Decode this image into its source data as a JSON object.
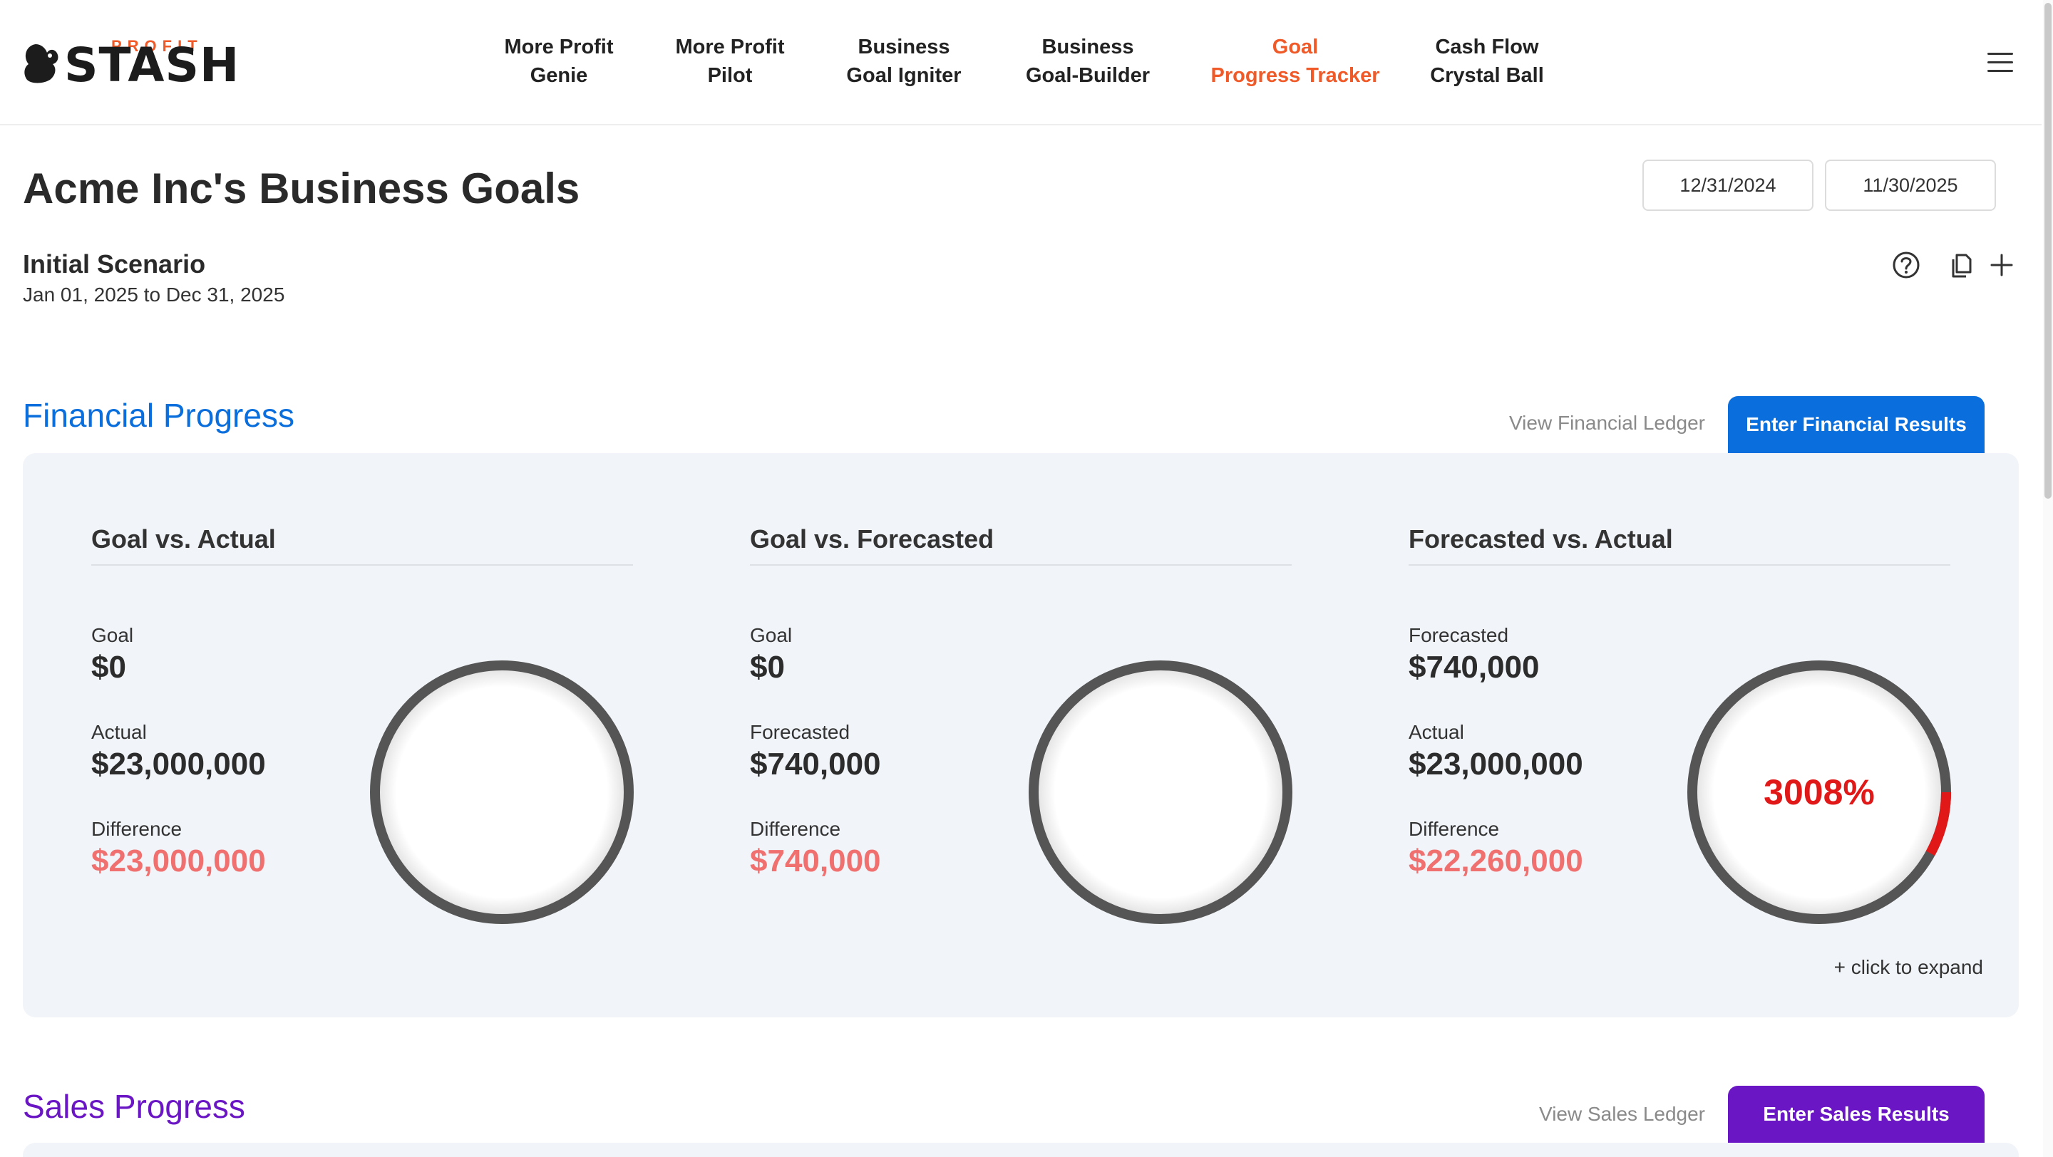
{
  "header": {
    "logo": {
      "top_word": "PROFIT",
      "main_word": "STASH"
    },
    "nav": [
      {
        "line1": "More Profit",
        "line2": "Genie",
        "active": false
      },
      {
        "line1": "More Profit",
        "line2": "Pilot",
        "active": false
      },
      {
        "line1": "Business",
        "line2": "Goal Igniter",
        "active": false
      },
      {
        "line1": "Business",
        "line2": "Goal-Builder",
        "active": false
      },
      {
        "line1": "Goal",
        "line2": "Progress Tracker",
        "active": true
      },
      {
        "line1": "Cash Flow",
        "line2": "Crystal Ball",
        "active": false
      }
    ],
    "menu_icon": "hamburger-menu-icon"
  },
  "page": {
    "title": "Acme Inc's Business Goals",
    "date_from": "12/31/2024",
    "date_to": "11/30/2025",
    "scenario_name": "Initial Scenario",
    "scenario_range": "Jan 01, 2025 to Dec 31, 2025",
    "icons": [
      "help-circle-icon",
      "copy-icon",
      "plus-icon"
    ]
  },
  "financial": {
    "title": "Financial Progress",
    "ledger_link": "View Financial Ledger",
    "enter_button": "Enter Financial Results",
    "expand_text": "+ click to expand",
    "cards": [
      {
        "title": "Goal vs. Actual",
        "label1": "Goal",
        "value1": "$0",
        "label2": "Actual",
        "value2": "$23,000,000",
        "label3": "Difference",
        "value3": "$23,000,000",
        "gauge_text": "",
        "gauge_fill_percent": 0
      },
      {
        "title": "Goal vs. Forecasted",
        "label1": "Goal",
        "value1": "$0",
        "label2": "Forecasted",
        "value2": "$740,000",
        "label3": "Difference",
        "value3": "$740,000",
        "gauge_text": "",
        "gauge_fill_percent": 0
      },
      {
        "title": "Forecasted vs. Actual",
        "label1": "Forecasted",
        "value1": "$740,000",
        "label2": "Actual",
        "value2": "$23,000,000",
        "label3": "Difference",
        "value3": "$22,260,000",
        "gauge_text": "3008%",
        "gauge_fill_percent": 8
      }
    ]
  },
  "sales": {
    "title": "Sales Progress",
    "ledger_link": "View Sales Ledger",
    "enter_button": "Enter Sales Results"
  },
  "colors": {
    "brand_orange": "#f05a28",
    "financial_blue": "#0a6fdc",
    "sales_purple": "#6a16c4",
    "negative_red": "#f07070",
    "gauge_red": "#e01818",
    "gauge_ring": "#555555"
  }
}
